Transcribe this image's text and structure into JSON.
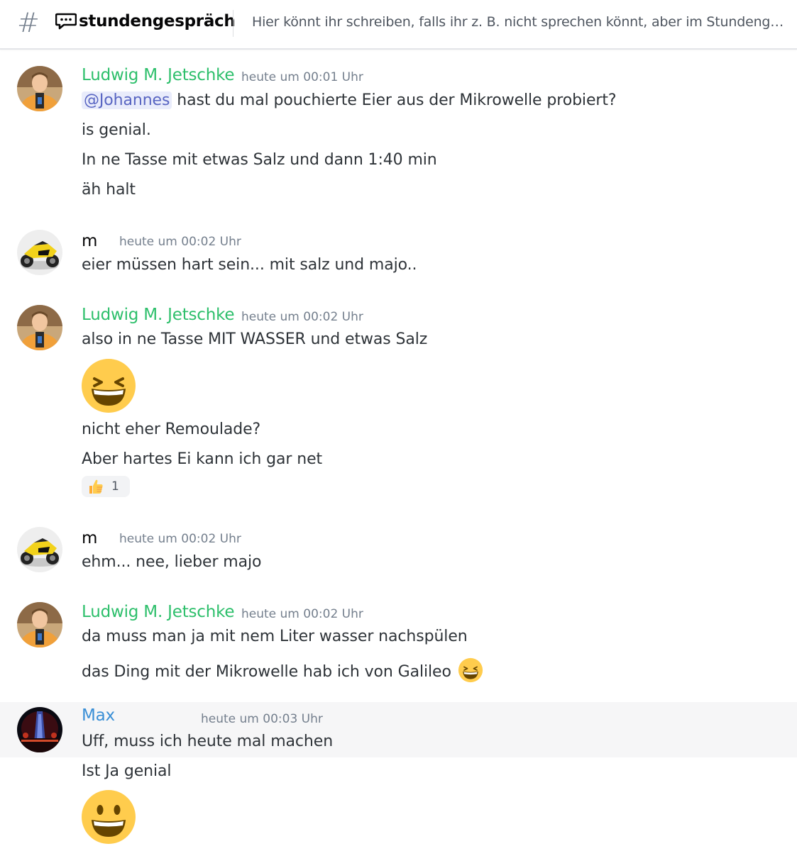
{
  "header": {
    "channel_name": "stundengespräch",
    "topic": "Hier könnt ihr schreiben, falls ihr z. B. nicht sprechen könnt, aber im Stundeng…"
  },
  "colors": {
    "ludwig_name": "#2dbf6b",
    "m_name": "#060607",
    "max_name": "#3a8fd6",
    "mention_bg": "#e9ecfb",
    "mention_text": "#5865c2",
    "highlight_bg": "#f6f6f7"
  },
  "messages": [
    {
      "author": "Ludwig M. Jetschke",
      "timestamp": "heute um 00:01 Uhr",
      "mention": "@Johannes",
      "lines": [
        "hast du mal pouchierte Eier aus der Mikrowelle probiert?",
        "is genial.",
        "In ne Tasse mit etwas Salz und dann 1:40 min",
        "äh halt"
      ]
    },
    {
      "author": "m",
      "timestamp": "heute um 00:02 Uhr",
      "lines": [
        "eier müssen hart sein... mit salz und majo.."
      ]
    },
    {
      "author": "Ludwig M. Jetschke",
      "timestamp": "heute um 00:02 Uhr",
      "lines": [
        "also in ne Tasse MIT WASSER und etwas Salz",
        "nicht eher Remoulade?",
        "Aber hartes Ei kann ich gar net"
      ],
      "big_emoji": "grinning-squinting-face",
      "reaction": {
        "emoji": "thumbs-up",
        "count": "1"
      }
    },
    {
      "author": "m",
      "timestamp": "heute um 00:02 Uhr",
      "lines": [
        "ehm... nee, lieber majo"
      ]
    },
    {
      "author": "Ludwig M. Jetschke",
      "timestamp": "heute um 00:02 Uhr",
      "lines": [
        "da muss man ja mit nem Liter wasser nachspülen",
        "das Ding mit der Mikrowelle hab ich von Galileo"
      ],
      "inline_emoji": "grinning-squinting-face"
    },
    {
      "author": "Max",
      "timestamp": "heute um 00:03 Uhr",
      "lines": [
        "Uff, muss ich heute mal machen",
        "Ist Ja genial"
      ],
      "big_emoji": "grinning-face"
    }
  ]
}
